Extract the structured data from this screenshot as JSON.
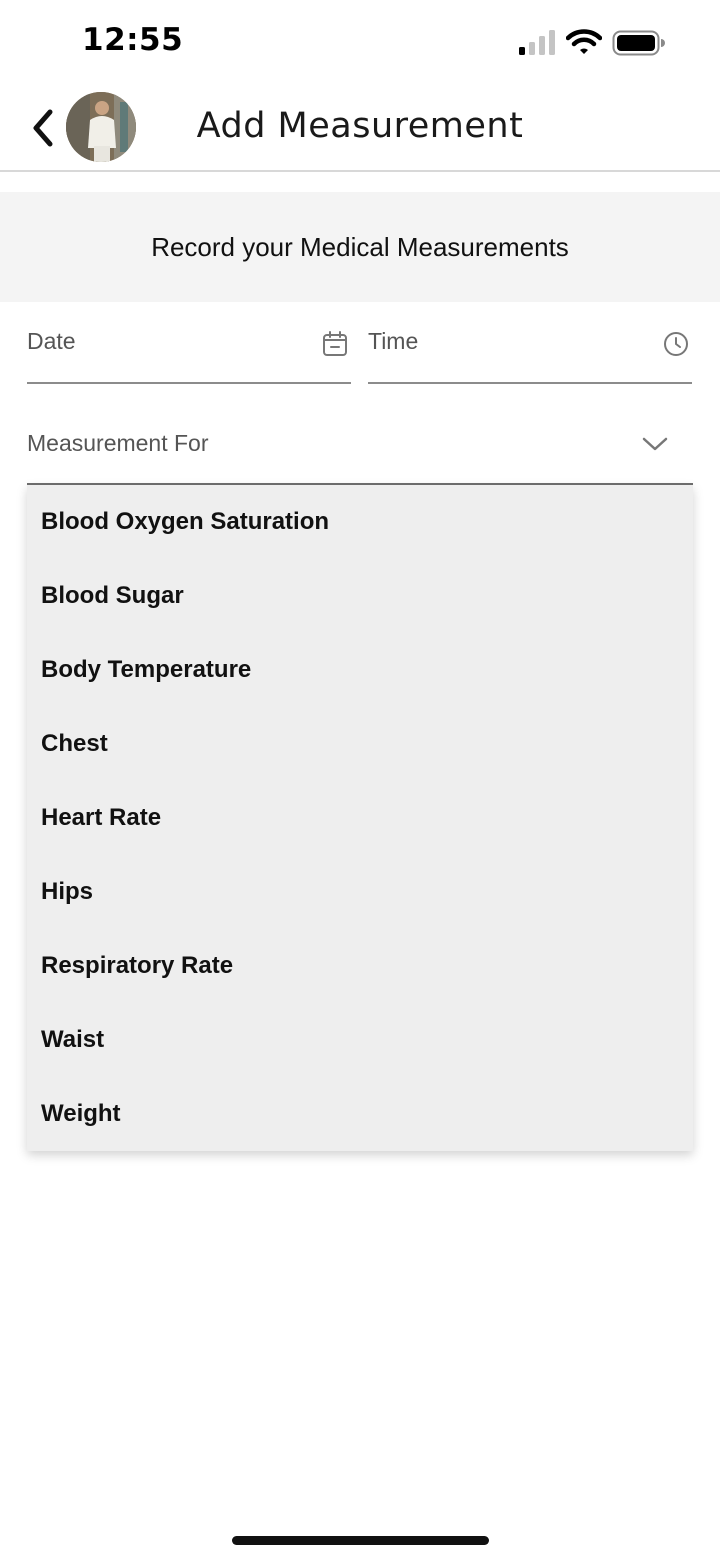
{
  "status_bar": {
    "time": "12:55"
  },
  "header": {
    "title": "Add Measurement"
  },
  "banner": {
    "text": "Record your Medical Measurements"
  },
  "form": {
    "date_label": "Date",
    "time_label": "Time",
    "measurement_for_label": "Measurement For"
  },
  "dropdown": {
    "options": [
      "Blood Oxygen Saturation",
      "Blood Sugar",
      "Body Temperature",
      "Chest",
      "Heart Rate",
      "Hips",
      "Respiratory Rate",
      "Waist",
      "Weight"
    ]
  },
  "icons": {
    "back": "chevron-left-icon",
    "date": "calendar-icon",
    "time": "clock-icon",
    "select": "chevron-down-icon",
    "signal": "cellular-signal-icon",
    "wifi": "wifi-icon",
    "battery": "battery-icon"
  },
  "colors": {
    "banner_background": "#f4f4f4",
    "dropdown_background": "#eeeeee",
    "text": "#111111",
    "label": "#555555"
  }
}
